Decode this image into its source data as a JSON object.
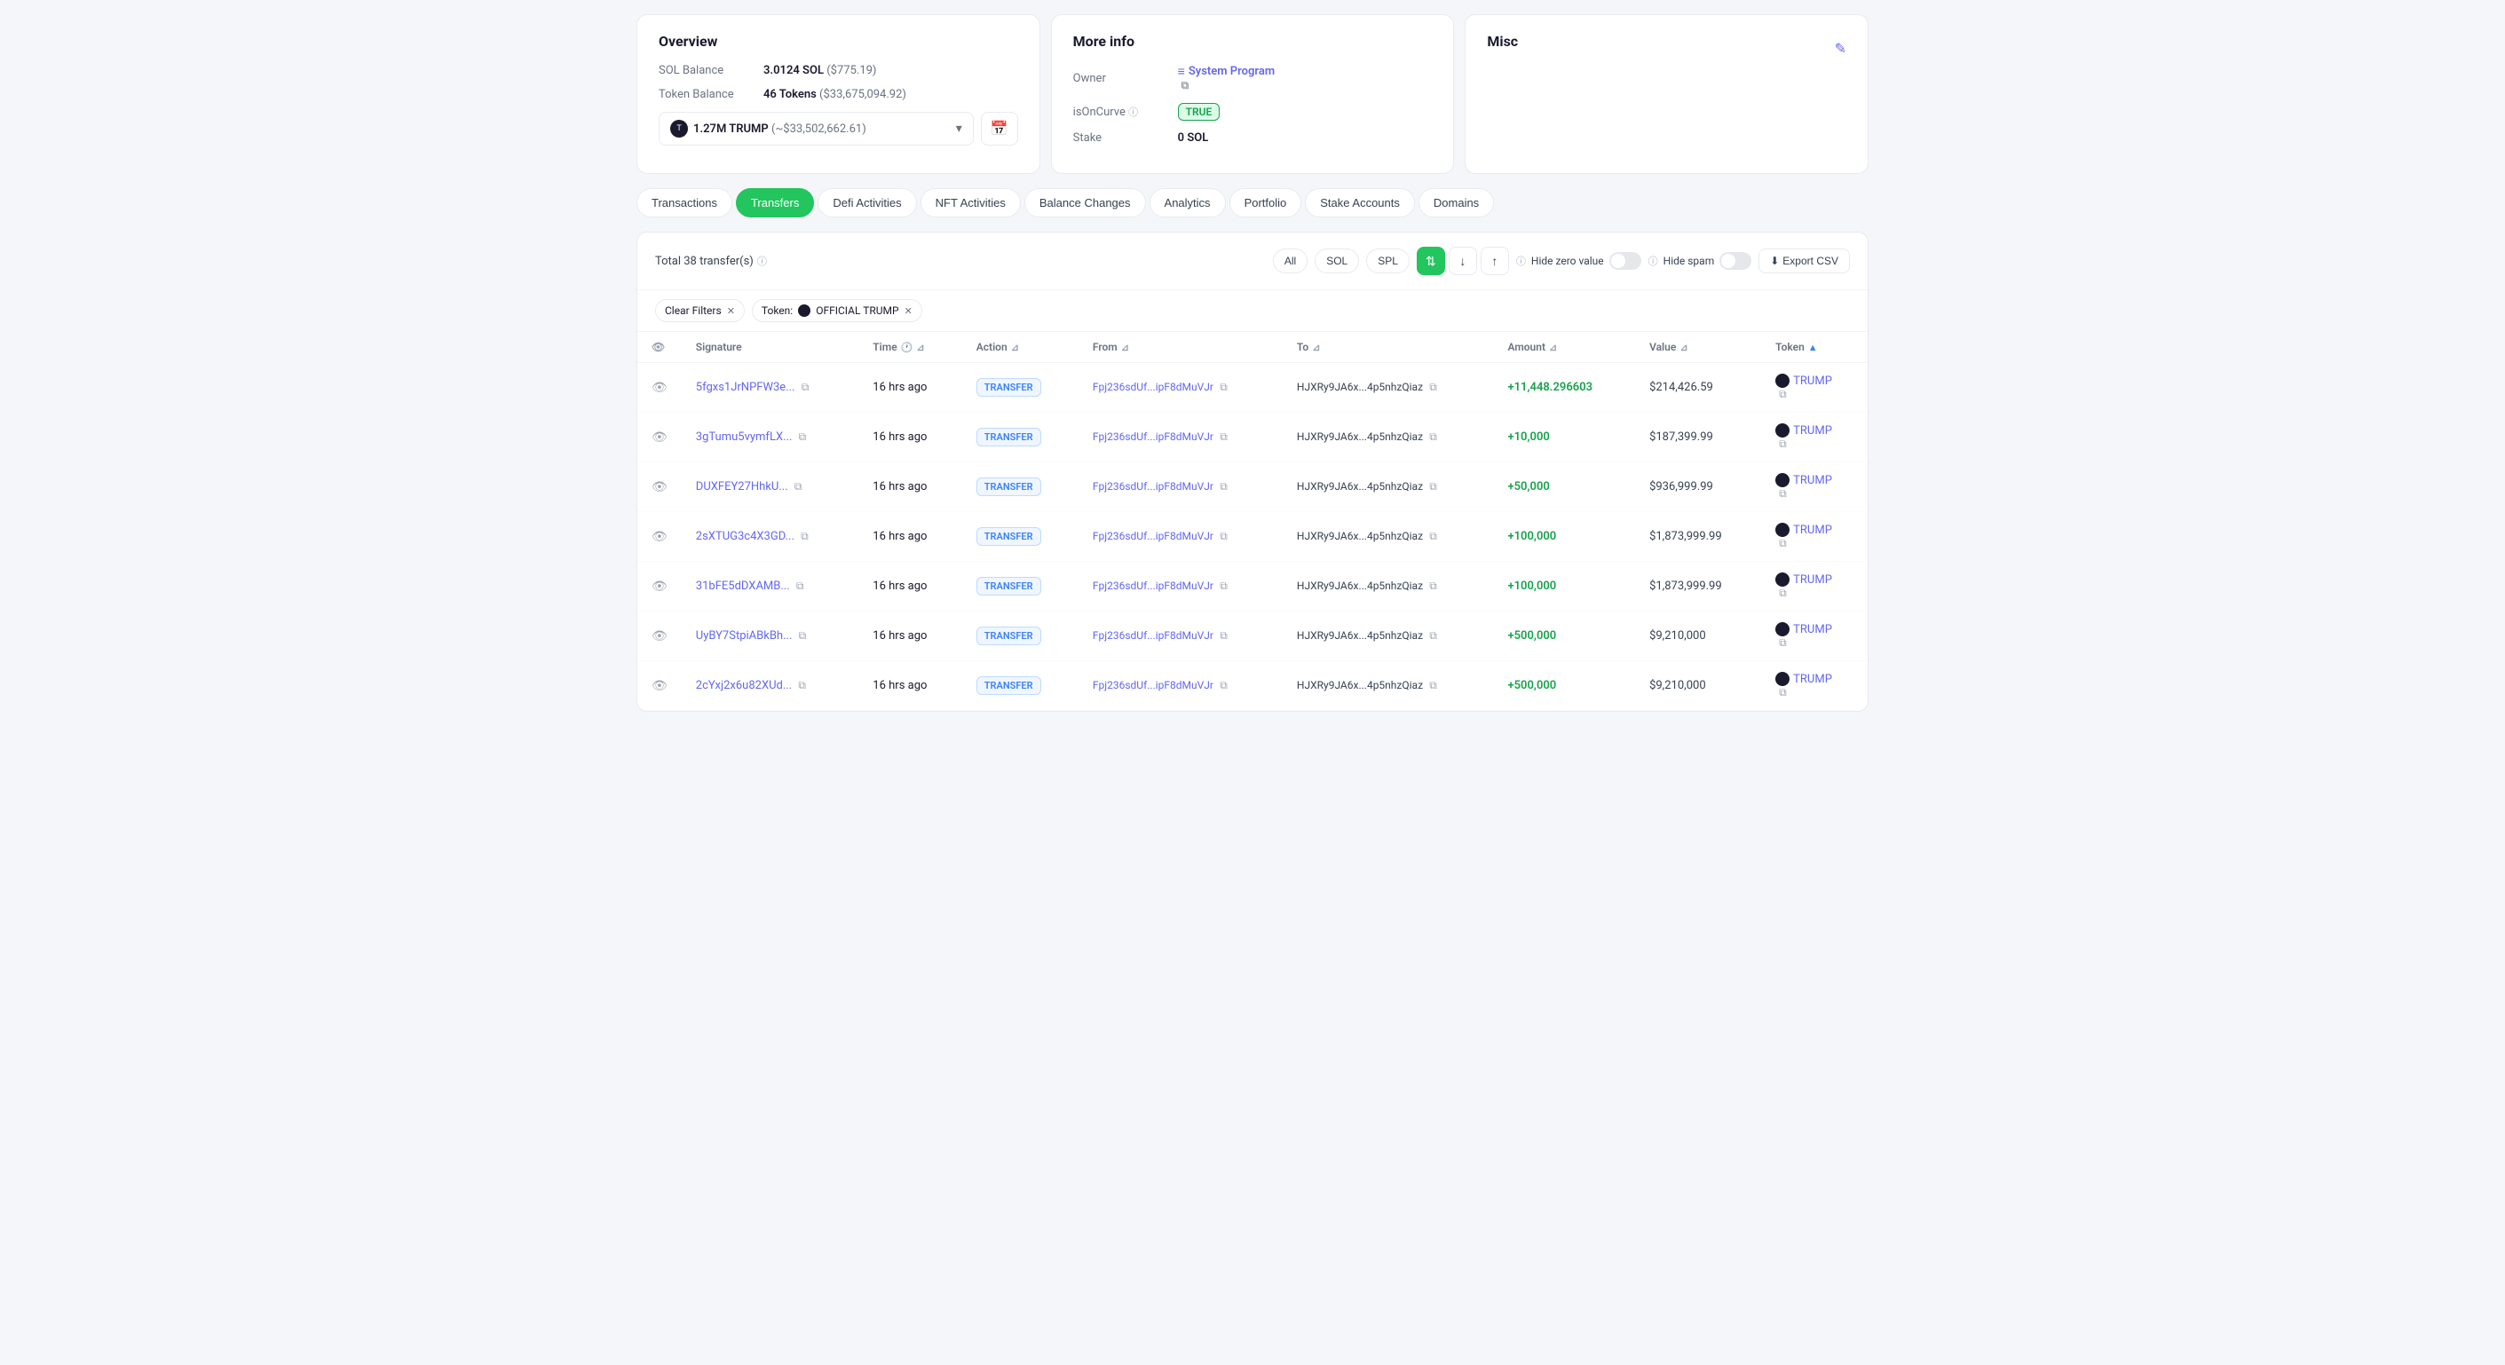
{
  "overview": {
    "title": "Overview",
    "sol_balance_label": "SOL Balance",
    "sol_balance_value": "3.0124 SOL",
    "sol_balance_usd": "($775.19)",
    "token_balance_label": "Token Balance",
    "token_balance_value": "46 Tokens",
    "token_balance_usd": "($33,675,094.92)",
    "token_name": "1.27M TRUMP",
    "token_value": "(~$33,502,662.61)"
  },
  "more_info": {
    "title": "More info",
    "owner_label": "Owner",
    "owner_value": "System Program",
    "is_on_curve_label": "isOnCurve",
    "is_on_curve_value": "TRUE",
    "stake_label": "Stake",
    "stake_value": "0 SOL"
  },
  "misc": {
    "title": "Misc"
  },
  "tabs": [
    {
      "label": "Transactions",
      "active": false
    },
    {
      "label": "Transfers",
      "active": true
    },
    {
      "label": "Defi Activities",
      "active": false
    },
    {
      "label": "NFT Activities",
      "active": false
    },
    {
      "label": "Balance Changes",
      "active": false
    },
    {
      "label": "Analytics",
      "active": false
    },
    {
      "label": "Portfolio",
      "active": false
    },
    {
      "label": "Stake Accounts",
      "active": false
    },
    {
      "label": "Domains",
      "active": false
    }
  ],
  "table": {
    "total_label": "Total 38 transfer(s)",
    "filter_all": "All",
    "filter_sol": "SOL",
    "filter_spl": "SPL",
    "hide_zero_label": "Hide zero value",
    "hide_spam_label": "Hide spam",
    "export_label": "Export CSV",
    "clear_filters": "Clear Filters",
    "token_filter_label": "Token:",
    "token_filter_value": "OFFICIAL TRUMP",
    "columns": {
      "signature": "Signature",
      "time": "Time",
      "action": "Action",
      "from": "From",
      "to": "To",
      "amount": "Amount",
      "value": "Value",
      "token": "Token"
    },
    "rows": [
      {
        "signature": "5fgxs1JrNPFW3e...",
        "time": "16 hrs ago",
        "action": "TRANSFER",
        "from": "Fpj236sdUf...ipF8dMuVJr",
        "to": "HJXRy9JA6x...4p5nhzQiaz",
        "amount": "+11,448.296603",
        "value": "$214,426.59",
        "token": "TRUMP"
      },
      {
        "signature": "3gTumu5vymfLX...",
        "time": "16 hrs ago",
        "action": "TRANSFER",
        "from": "Fpj236sdUf...ipF8dMuVJr",
        "to": "HJXRy9JA6x...4p5nhzQiaz",
        "amount": "+10,000",
        "value": "$187,399.99",
        "token": "TRUMP"
      },
      {
        "signature": "DUXFEY27HhkU...",
        "time": "16 hrs ago",
        "action": "TRANSFER",
        "from": "Fpj236sdUf...ipF8dMuVJr",
        "to": "HJXRy9JA6x...4p5nhzQiaz",
        "amount": "+50,000",
        "value": "$936,999.99",
        "token": "TRUMP"
      },
      {
        "signature": "2sXTUG3c4X3GD...",
        "time": "16 hrs ago",
        "action": "TRANSFER",
        "from": "Fpj236sdUf...ipF8dMuVJr",
        "to": "HJXRy9JA6x...4p5nhzQiaz",
        "amount": "+100,000",
        "value": "$1,873,999.99",
        "token": "TRUMP"
      },
      {
        "signature": "31bFE5dDXAMB...",
        "time": "16 hrs ago",
        "action": "TRANSFER",
        "from": "Fpj236sdUf...ipF8dMuVJr",
        "to": "HJXRy9JA6x...4p5nhzQiaz",
        "amount": "+100,000",
        "value": "$1,873,999.99",
        "token": "TRUMP"
      },
      {
        "signature": "UyBY7StpiABkBh...",
        "time": "16 hrs ago",
        "action": "TRANSFER",
        "from": "Fpj236sdUf...ipF8dMuVJr",
        "to": "HJXRy9JA6x...4p5nhzQiaz",
        "amount": "+500,000",
        "value": "$9,210,000",
        "token": "TRUMP"
      },
      {
        "signature": "2cYxj2x6u82XUd...",
        "time": "16 hrs ago",
        "action": "TRANSFER",
        "from": "Fpj236sdUf...ipF8dMuVJr",
        "to": "HJXRy9JA6x...4p5nhzQiaz",
        "amount": "+500,000",
        "value": "$9,210,000",
        "token": "TRUMP"
      }
    ]
  },
  "colors": {
    "accent_green": "#22c55e",
    "accent_blue": "#6366f1",
    "amount_green": "#16a34a",
    "badge_blue_bg": "#eff6ff",
    "badge_blue_border": "#bfdbfe",
    "badge_blue_text": "#3b82f6"
  }
}
